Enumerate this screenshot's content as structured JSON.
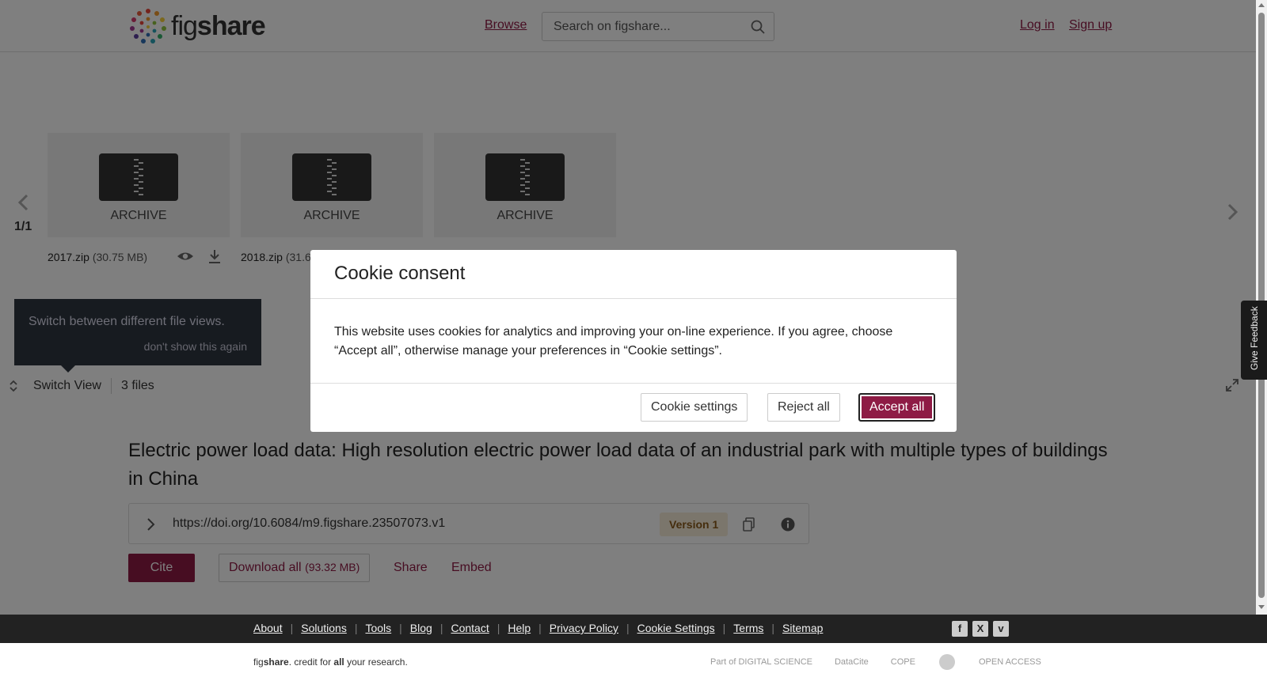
{
  "header": {
    "logo_prefix": "fig",
    "logo_bold": "share",
    "browse": "Browse",
    "search_placeholder": "Search on figshare...",
    "login": "Log in",
    "signup": "Sign up"
  },
  "viewer": {
    "pager": "1/1",
    "card_label": "ARCHIVE",
    "files": [
      {
        "name": "2017.zip",
        "size": "(30.75 MB)"
      },
      {
        "name": "2018.zip",
        "size": "(31.6"
      }
    ],
    "tooltip": {
      "text": "Switch between different file views.",
      "dismiss": "don't show this again"
    },
    "switch_view": "Switch View",
    "files_count": "3 files"
  },
  "item": {
    "title": "Electric power load data: High resolution electric power load data of an industrial park with multiple types of buildings in China",
    "doi": "https://doi.org/10.6084/m9.figshare.23507073.v1",
    "version": "Version 1",
    "cite": "Cite",
    "download_all": "Download all",
    "download_size": "(93.32 MB)",
    "share": "Share",
    "embed": "Embed"
  },
  "cookie": {
    "title": "Cookie consent",
    "body": "This website uses cookies for analytics and improving your on-line experience. If you agree, choose “Accept all”, otherwise manage your preferences in “Cookie settings”.",
    "settings": "Cookie settings",
    "reject": "Reject all",
    "accept": "Accept all"
  },
  "footer": {
    "links": [
      "About",
      "Solutions",
      "Tools",
      "Blog",
      "Contact",
      "Help",
      "Privacy Policy",
      "Cookie Settings",
      "Terms",
      "Sitemap"
    ],
    "tagline_prefix": "fig",
    "tagline_bold": "share",
    "tagline_mid": ". credit for ",
    "tagline_all": "all",
    "tagline_end": " your research.",
    "partners": [
      "Part of DIGITAL SCIENCE",
      "DataCite",
      "COPE",
      "",
      "OPEN ACCESS"
    ]
  },
  "feedback": "Give Feedback",
  "colors": {
    "brand": "#8e1b45",
    "tooltip_bg": "#2e3640",
    "footer_bg": "#222222"
  }
}
